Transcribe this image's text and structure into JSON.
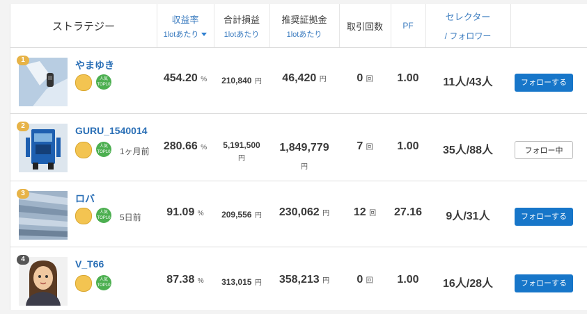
{
  "header": {
    "strategy": "ストラテジー",
    "profit_rate": "収益率",
    "profit_rate_sub": "1lotあたり",
    "total_pl": "合計損益",
    "total_pl_sub": "1lotあたり",
    "margin": "推奨証拠金",
    "margin_sub": "1lotあたり",
    "trades": "取引回数",
    "pf": "PF",
    "selector": "セレクター",
    "selector_sub": "/ フォロワー"
  },
  "badges": {
    "popular_top": "人気",
    "popular_bottom": "TOP10"
  },
  "rows": [
    {
      "rank": "1",
      "name": "やまゆき",
      "ago": "",
      "rate": "454.20",
      "rate_unit": "%",
      "pl": "210,840",
      "pl_unit": "円",
      "margin": "46,420",
      "margin_unit": "円",
      "trades": "0",
      "trades_unit": "回",
      "pf": "1.00",
      "sel": "11人/43人",
      "button": "フォローする",
      "following": false
    },
    {
      "rank": "2",
      "name": "GURU_1540014",
      "ago": "1ヶ月前",
      "rate": "280.66",
      "rate_unit": "%",
      "pl": "5,191,500",
      "pl_unit": "円",
      "margin": "1,849,779",
      "margin_unit": "円",
      "trades": "7",
      "trades_unit": "回",
      "pf": "1.00",
      "sel": "35人/88人",
      "button": "フォロー中",
      "following": true
    },
    {
      "rank": "3",
      "name": "ロバ",
      "ago": "5日前",
      "rate": "91.09",
      "rate_unit": "%",
      "pl": "209,556",
      "pl_unit": "円",
      "margin": "230,062",
      "margin_unit": "円",
      "trades": "12",
      "trades_unit": "回",
      "pf": "27.16",
      "sel": "9人/31人",
      "button": "フォローする",
      "following": false
    },
    {
      "rank": "4",
      "name": "V_T66",
      "ago": "",
      "rate": "87.38",
      "rate_unit": "%",
      "pl": "313,015",
      "pl_unit": "円",
      "margin": "358,213",
      "margin_unit": "円",
      "trades": "0",
      "trades_unit": "回",
      "pf": "1.00",
      "sel": "16人/28人",
      "button": "フォローする",
      "following": false
    }
  ],
  "colors": {
    "accent": "#1776c9",
    "rank_gold": "#e7b347",
    "rank_dark": "#555555",
    "popular_green": "#4caf50"
  }
}
